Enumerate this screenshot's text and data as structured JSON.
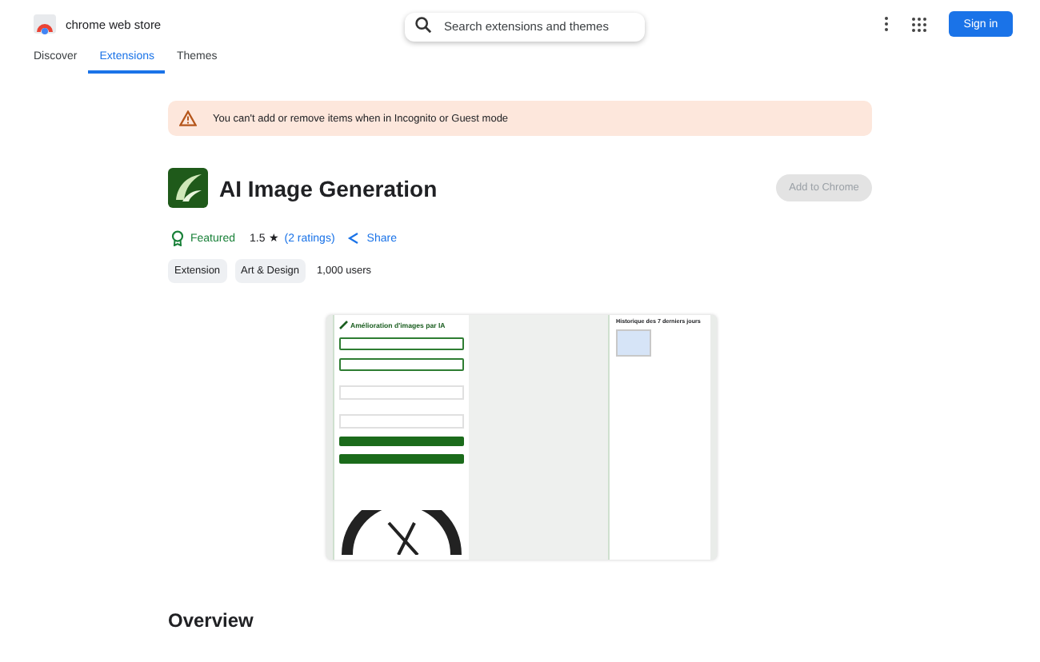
{
  "header": {
    "brand": "chrome web store",
    "search": {
      "placeholder": "Search extensions and themes"
    },
    "sign_in": "Sign in"
  },
  "tabs": [
    {
      "label": "Discover",
      "selected": false
    },
    {
      "label": "Extensions",
      "selected": true
    },
    {
      "label": "Themes",
      "selected": false
    }
  ],
  "banner": {
    "message": "You can't add or remove items when in Incognito or Guest mode"
  },
  "extension": {
    "title": "AI Image Generation",
    "add_button": {
      "label": "Add to Chrome",
      "disabled": true
    },
    "featured": "Featured",
    "rating": "1.5",
    "stars_glyph": "★",
    "ratings_link": "(2 ratings)",
    "share": "Share",
    "tags": [
      "Extension",
      "Art & Design"
    ],
    "users": "1,000 users"
  },
  "screenshot": {
    "heading": "Amélioration d'images par IA",
    "history_heading": "Historique des 7 derniers jours"
  },
  "overview": {
    "heading": "Overview"
  }
}
